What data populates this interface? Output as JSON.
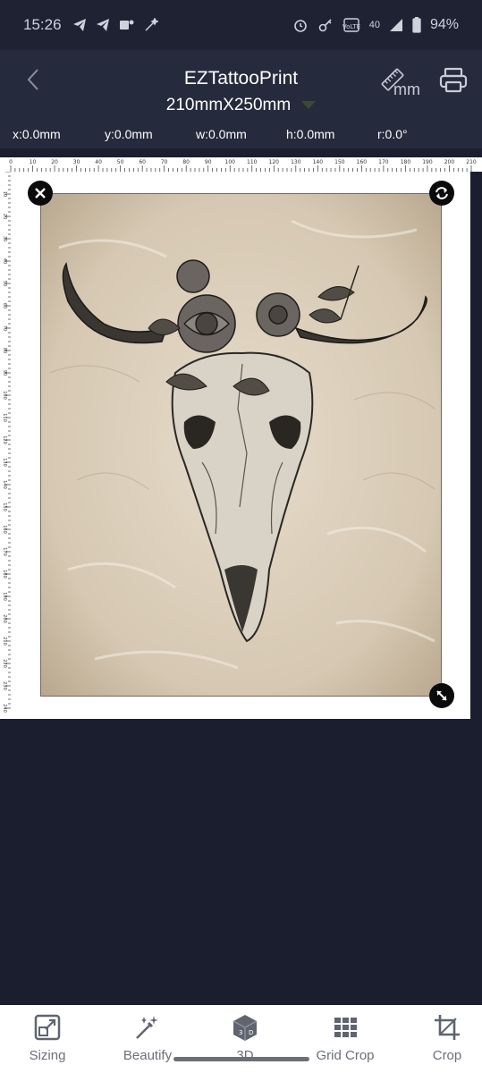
{
  "status_bar": {
    "time": "15:26",
    "signal_text": "40",
    "battery": "94%",
    "icons": [
      "telegram-icon",
      "telegram-icon",
      "teams-icon",
      "magic-icon",
      "alarm-icon",
      "key-icon",
      "wifi-icon",
      "signal-icon",
      "battery-icon"
    ]
  },
  "header": {
    "title": "EZTattooPrint",
    "size": "210mmX250mm",
    "unit": "mm",
    "icons": {
      "back": "chevron-left-icon",
      "unit": "ruler-icon",
      "print": "printer-icon"
    }
  },
  "coords": {
    "x": "x:0.0mm",
    "y": "y:0.0mm",
    "w": "w:0.0mm",
    "h": "h:0.0mm",
    "r": "r:0.0°"
  },
  "ruler": {
    "top_labels": [
      "0",
      "10",
      "20",
      "30",
      "40",
      "50",
      "60",
      "70",
      "80",
      "90",
      "100",
      "110",
      "120",
      "130",
      "140",
      "150",
      "160",
      "170",
      "180",
      "190",
      "200",
      "210"
    ],
    "left_labels": [
      "10",
      "20",
      "30",
      "40",
      "50",
      "60",
      "70",
      "80",
      "90",
      "100",
      "110",
      "120",
      "130",
      "140",
      "150",
      "160",
      "170",
      "180",
      "190",
      "200",
      "210",
      "220",
      "230",
      "240"
    ]
  },
  "handles": {
    "close": "close-icon",
    "rotate": "rotate-icon",
    "resize": "resize-icon"
  },
  "nav": [
    {
      "label": "Sizing",
      "icon": "sizing-icon"
    },
    {
      "label": "Beautify",
      "icon": "magic-wand-icon"
    },
    {
      "label": "3D",
      "icon": "cube-3d-icon"
    },
    {
      "label": "Grid Crop",
      "icon": "grid-icon"
    },
    {
      "label": "Crop",
      "icon": "crop-icon"
    }
  ],
  "colors": {
    "background": "#1b1e2f",
    "header": "#262a3d",
    "paper": "#ffffff",
    "nav_bg": "#ffffff",
    "nav_text": "#6a6f7a"
  }
}
